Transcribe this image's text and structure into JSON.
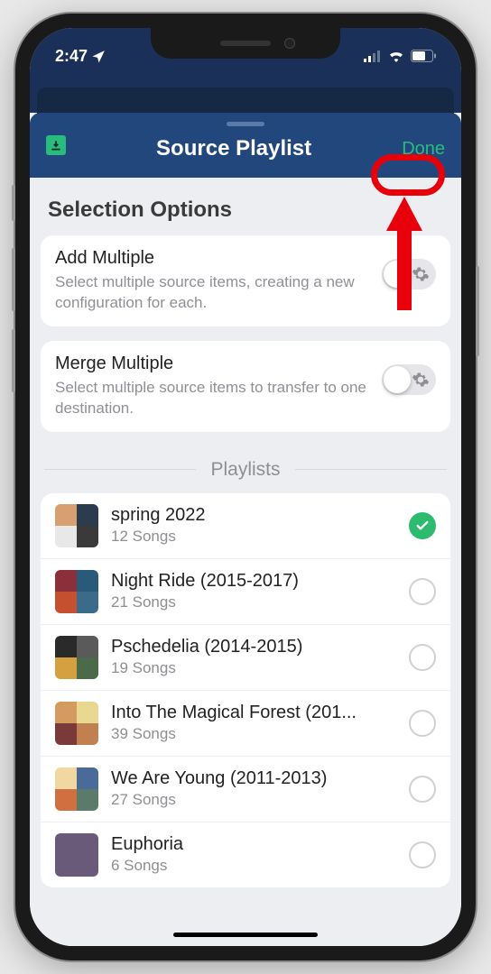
{
  "status": {
    "time": "2:47",
    "signal_bars": 2,
    "battery_pct": 60
  },
  "header": {
    "title": "Source Playlist",
    "done_label": "Done"
  },
  "selection": {
    "heading": "Selection Options",
    "options": [
      {
        "title": "Add Multiple",
        "desc": "Select multiple source items, creating a new configuration for each.",
        "enabled": false,
        "has_gear": true
      },
      {
        "title": "Merge Multiple",
        "desc": "Select multiple source items to transfer to one destination.",
        "enabled": false,
        "has_gear": true
      }
    ]
  },
  "playlists": {
    "heading": "Playlists",
    "items": [
      {
        "name": "spring 2022",
        "count": "12 Songs",
        "selected": true,
        "colors": [
          "#d8a070",
          "#2d3b4f",
          "#e8e8e8",
          "#3a3a3a"
        ]
      },
      {
        "name": "Night Ride (2015-2017)",
        "count": "21 Songs",
        "selected": false,
        "colors": [
          "#8b2f3a",
          "#2a5a7a",
          "#c45030",
          "#3a6b8a"
        ]
      },
      {
        "name": "Pschedelia (2014-2015)",
        "count": "19 Songs",
        "selected": false,
        "colors": [
          "#2a2a2a",
          "#5a5a5a",
          "#d4a040",
          "#4a6a4a"
        ]
      },
      {
        "name": "Into The Magical Forest (201...",
        "count": "39 Songs",
        "selected": false,
        "colors": [
          "#d49a60",
          "#e8d890",
          "#7a3a3a",
          "#c08050"
        ]
      },
      {
        "name": "We Are Young (2011-2013)",
        "count": "27 Songs",
        "selected": false,
        "colors": [
          "#f0d8a0",
          "#4a6a9a",
          "#d07040",
          "#5a7a6a"
        ]
      },
      {
        "name": "Euphoria",
        "count": "6 Songs",
        "selected": false,
        "colors": [
          "#6a5a7a",
          "#6a5a7a",
          "#6a5a7a",
          "#6a5a7a"
        ],
        "full": true
      }
    ]
  }
}
